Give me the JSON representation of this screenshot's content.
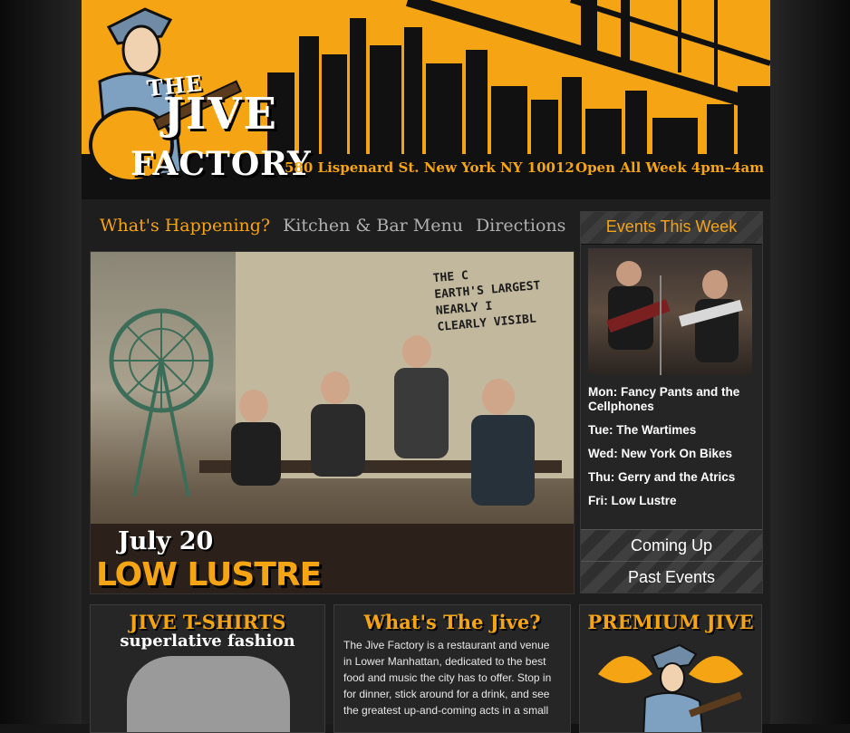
{
  "header": {
    "logo": {
      "line1": "THE",
      "line2": "JIVE",
      "line3": "FACTORY"
    },
    "address": "580 Lispenard St. New York NY 10012",
    "hours": "Open All Week 4pm–4am"
  },
  "nav": {
    "items": [
      {
        "label": "What's Happening?",
        "active": true
      },
      {
        "label": "Kitchen & Bar Menu",
        "active": false
      },
      {
        "label": "Directions",
        "active": false
      }
    ]
  },
  "hero": {
    "date": "July 20",
    "band": "LOW LUSTRE",
    "mural_text": [
      "THE C",
      "EARTH'S LARGEST",
      "NEARLY I",
      "CLEARLY VISIBL"
    ]
  },
  "sidebar": {
    "title": "Events This Week",
    "events": [
      {
        "day": "Mon:",
        "name": "Fancy Pants and the Cellphones"
      },
      {
        "day": "Tue:",
        "name": "The Wartimes"
      },
      {
        "day": "Wed:",
        "name": "New York On Bikes"
      },
      {
        "day": "Thu:",
        "name": "Gerry and the Atrics"
      },
      {
        "day": "Fri:",
        "name": "Low Lustre"
      }
    ],
    "coming_up": "Coming Up",
    "past_events": "Past Events"
  },
  "boxes": {
    "tshirts": {
      "title": "JIVE T-SHIRTS",
      "subtitle": "superlative fashion"
    },
    "about": {
      "title": "What's The Jive?",
      "body": "The Jive Factory is a restaurant and venue in Lower Manhattan, dedicated to the best food and music the city has to offer. Stop in for dinner, stick around for a drink, and see the greatest up-and-coming acts in a small"
    },
    "premium": {
      "title": "PREMIUM JIVE"
    }
  },
  "colors": {
    "accent": "#f5a414",
    "background": "#151515",
    "text": "#ffffff"
  }
}
